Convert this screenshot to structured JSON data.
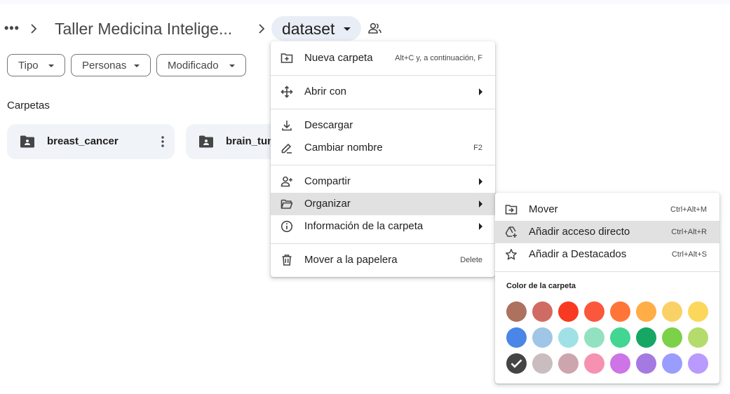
{
  "breadcrumb": {
    "more_label": "•••",
    "parent": "Taller Medicina Intelige...",
    "current": "dataset",
    "people_icon": "shared-people-icon"
  },
  "filters": [
    {
      "label": "Tipo"
    },
    {
      "label": "Personas"
    },
    {
      "label": "Modificado"
    }
  ],
  "section": {
    "title": "Carpetas"
  },
  "folders": [
    {
      "name": "breast_cancer"
    },
    {
      "name": "brain_tum"
    }
  ],
  "context_menu": {
    "items": [
      {
        "label": "Nueva carpeta",
        "shortcut": "Alt+C y, a continuación, F",
        "icon": "new-folder-icon"
      },
      {
        "label": "Abrir con",
        "icon": "move-arrows-icon",
        "submenu": true
      },
      {
        "label": "Descargar",
        "icon": "download-icon"
      },
      {
        "label": "Cambiar nombre",
        "shortcut": "F2",
        "icon": "rename-pencil-icon"
      },
      {
        "label": "Compartir",
        "icon": "share-person-add-icon",
        "submenu": true
      },
      {
        "label": "Organizar",
        "icon": "folder-open-icon",
        "submenu": true,
        "highlighted": true
      },
      {
        "label": "Información de la carpeta",
        "icon": "info-icon",
        "submenu": true
      },
      {
        "label": "Mover a la papelera",
        "shortcut": "Delete",
        "icon": "trash-icon"
      }
    ]
  },
  "organize_menu": {
    "items": [
      {
        "label": "Mover",
        "shortcut": "Ctrl+Alt+M",
        "icon": "move-to-folder-icon"
      },
      {
        "label": "Añadir acceso directo",
        "shortcut": "Ctrl+Alt+R",
        "icon": "add-shortcut-icon",
        "highlighted": true
      },
      {
        "label": "Añadir a Destacados",
        "shortcut": "Ctrl+Alt+S",
        "icon": "star-icon"
      }
    ],
    "color_title": "Color de la carpeta",
    "colors": [
      [
        "#ac725e",
        "#d06b64",
        "#f83a22",
        "#fa573c",
        "#ff7537",
        "#ffad46",
        "#fad165",
        "#fbd75b"
      ],
      [
        "#4986e7",
        "#9fc6e7",
        "#9fe1e7",
        "#92e1c0",
        "#42d692",
        "#16a765",
        "#7bd148",
        "#b3dc6c"
      ],
      [
        "#444444",
        "#cabdbf",
        "#cca6ac",
        "#f691b2",
        "#cd74e6",
        "#a47ae2",
        "#9a9cff",
        "#b99aff"
      ]
    ],
    "selected_color": "#444444"
  }
}
